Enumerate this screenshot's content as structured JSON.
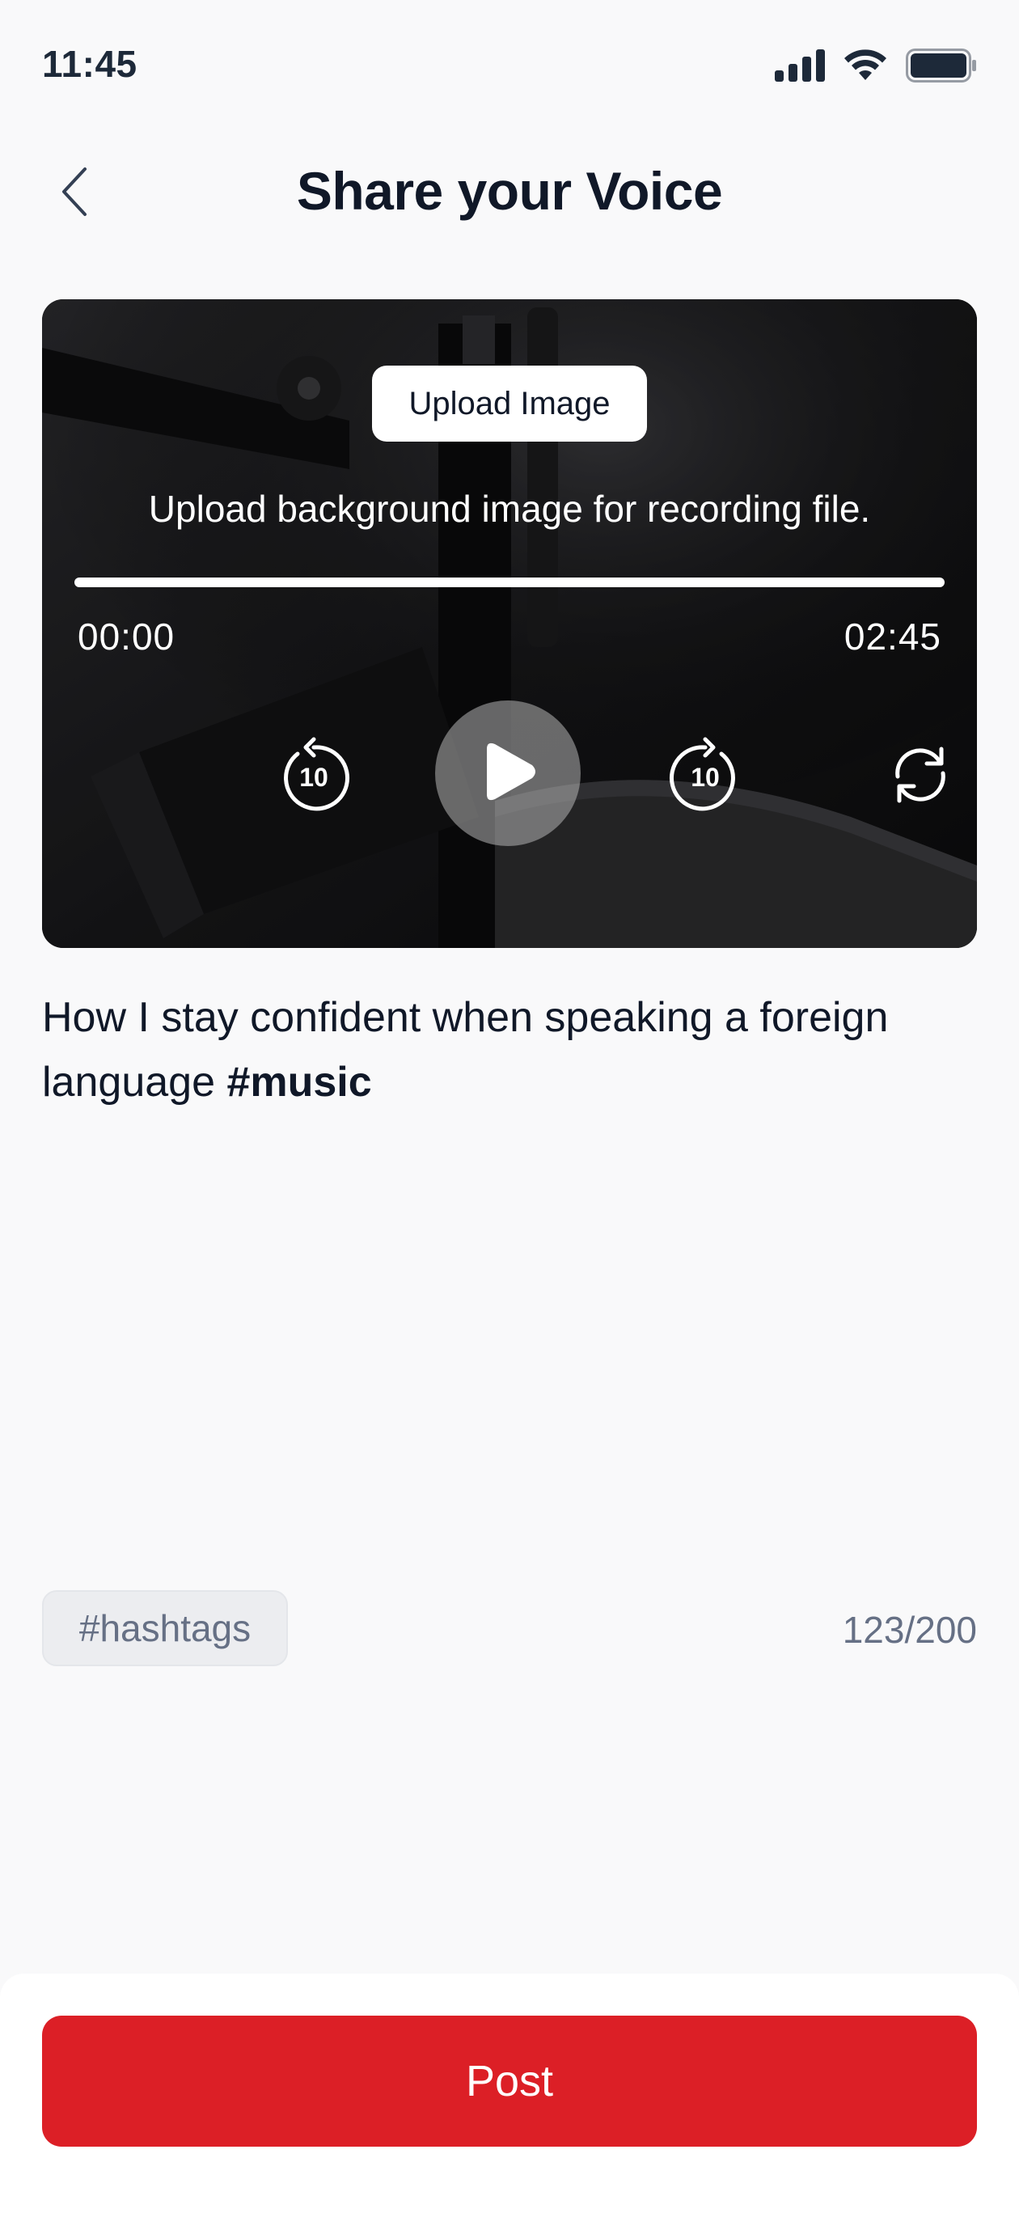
{
  "status_bar": {
    "time": "11:45",
    "icons": [
      "signal-icon",
      "wifi-icon",
      "battery-icon"
    ]
  },
  "header": {
    "back_icon": "chevron-left-icon",
    "title": "Share your Voice"
  },
  "player": {
    "upload_button_label": "Upload Image",
    "upload_hint": "Upload background image for recording file.",
    "current_time": "00:00",
    "total_time": "02:45",
    "progress": 0,
    "rewind_label": "10",
    "forward_label": "10",
    "controls": [
      "rewind-10-icon",
      "play-icon",
      "forward-10-icon",
      "repeat-icon"
    ]
  },
  "caption": {
    "text": "How I stay confident when speaking a foreign language ",
    "hashtag": "#music"
  },
  "composer": {
    "hashtags_button": "#hashtags",
    "char_count": "123/200"
  },
  "footer": {
    "post_label": "Post"
  },
  "colors": {
    "accent": "#dc1f26",
    "text_primary": "#101828",
    "text_secondary": "#667085",
    "background": "#f9f9fa"
  }
}
